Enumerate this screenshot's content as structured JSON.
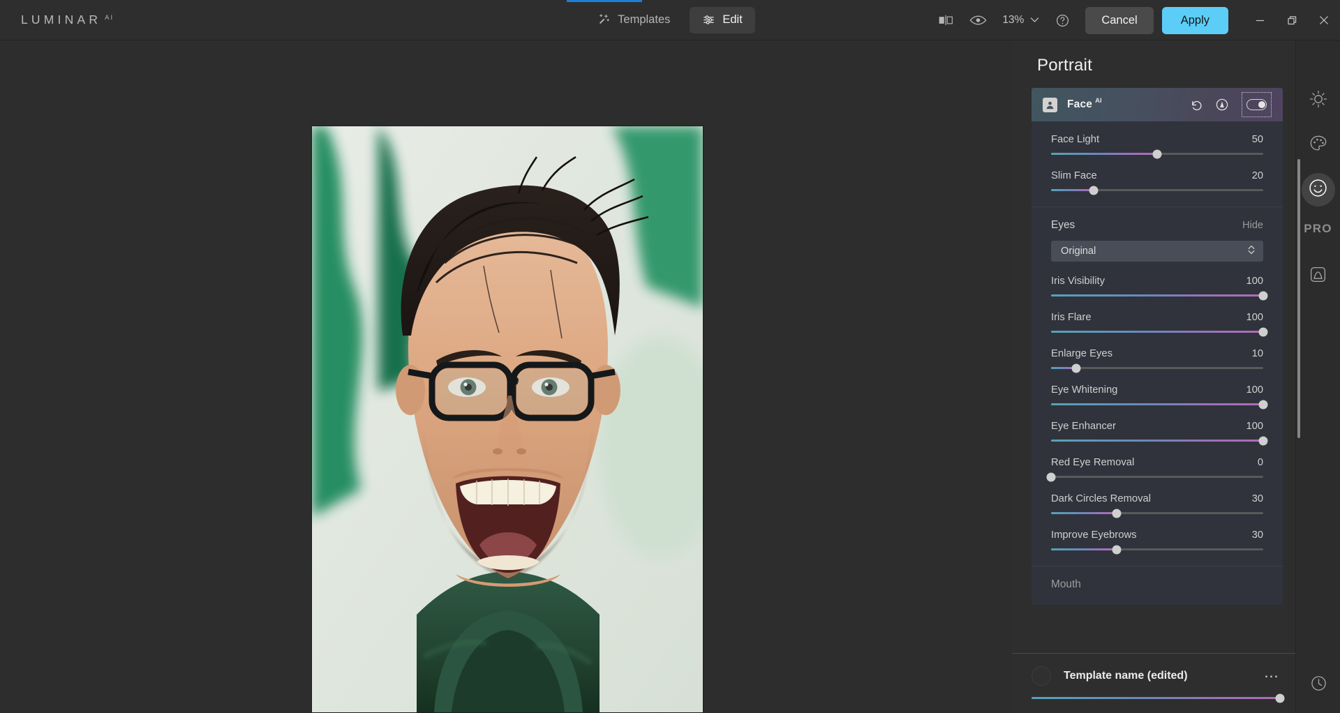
{
  "app": {
    "logo": "LUMINAR",
    "logo_sup": "AI",
    "accent": "#5ccdf7",
    "tab_indicator_color": "#1d7fd4"
  },
  "topbar": {
    "templates_label": "Templates",
    "templates_icon": "magic-wand-sparkle-icon",
    "edit_label": "Edit",
    "edit_icon": "sliders-icon",
    "compare_icon": "before-after-compare-icon",
    "preview_icon": "eye-icon",
    "zoom_level": "13%",
    "zoom_chevron_icon": "chevron-down-icon",
    "help_icon": "help-circle-icon",
    "cancel_label": "Cancel",
    "apply_label": "Apply",
    "minimize_icon": "minimize-icon",
    "restore_icon": "restore-window-icon",
    "close_icon": "close-icon"
  },
  "panel": {
    "title": "Portrait",
    "tool": {
      "name": "Face",
      "sup": "AI",
      "icon": "person-portrait-icon",
      "reset_icon": "undo-reset-icon",
      "mask_icon": "masking-circle-a-icon",
      "toggle_icon": "toggle-switch-on",
      "toggle_state": "on"
    },
    "face_sliders": [
      {
        "label": "Face Light",
        "value": "50",
        "pct": 50
      },
      {
        "label": "Slim Face",
        "value": "20",
        "pct": 20
      }
    ],
    "eyes_section": {
      "title": "Eyes",
      "hide_label": "Hide",
      "dropdown_value": "Original",
      "dropdown_icon": "chevron-up-down-icon",
      "sliders": [
        {
          "label": "Iris Visibility",
          "value": "100",
          "pct": 100
        },
        {
          "label": "Iris Flare",
          "value": "100",
          "pct": 100
        },
        {
          "label": "Enlarge Eyes",
          "value": "10",
          "pct": 12
        },
        {
          "label": "Eye Whitening",
          "value": "100",
          "pct": 100
        },
        {
          "label": "Eye Enhancer",
          "value": "100",
          "pct": 100
        },
        {
          "label": "Red Eye Removal",
          "value": "0",
          "pct": 0
        },
        {
          "label": "Dark Circles Removal",
          "value": "30",
          "pct": 31
        },
        {
          "label": "Improve Eyebrows",
          "value": "30",
          "pct": 31
        }
      ]
    },
    "mouth_section": {
      "title": "Mouth"
    },
    "bottom": {
      "template_name": "Template name (edited)",
      "menu_icon": "more-options-dots-icon",
      "thumbnail_icon": "template-thumbnail",
      "amount_pct": 100
    }
  },
  "rail": {
    "items": [
      {
        "name": "essentials",
        "icon": "sun-icon",
        "active": false
      },
      {
        "name": "creative",
        "icon": "palette-icon",
        "active": false
      },
      {
        "name": "portrait",
        "icon": "smiley-face-icon",
        "active": true
      }
    ],
    "pro_label": "PRO",
    "professional_icon": "landscape-square-icon",
    "history_icon": "history-clock-icon"
  }
}
